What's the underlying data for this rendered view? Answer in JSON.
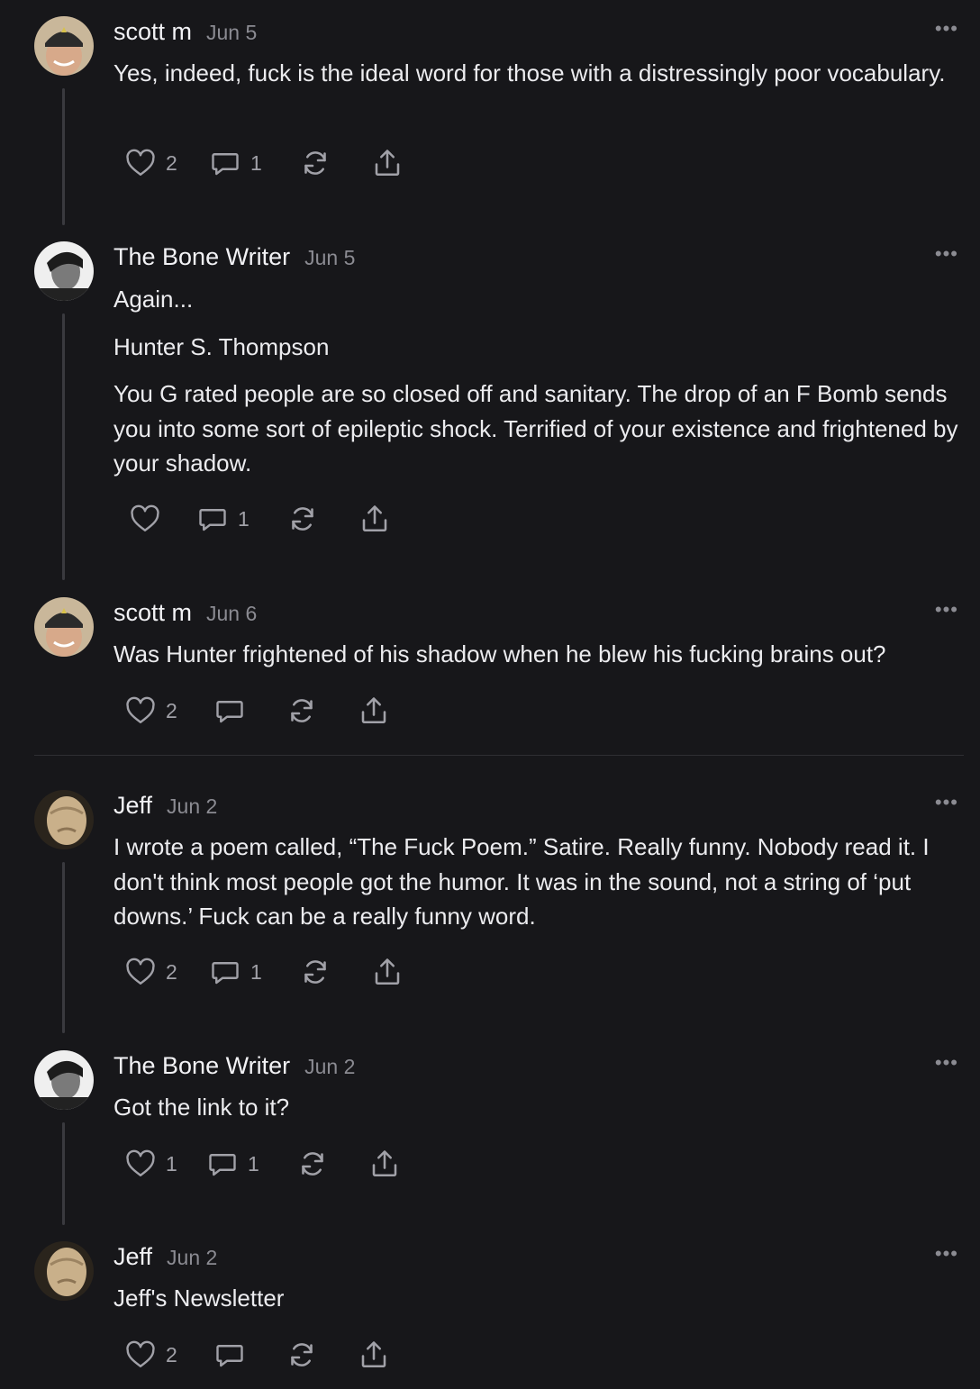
{
  "comments": [
    {
      "author": "scott m",
      "date": "Jun 5",
      "paragraphs": [
        "Yes, indeed, fuck is the ideal word for those with a distressingly poor vocabulary."
      ],
      "likes": "2",
      "replies": "1",
      "more_label": "•••"
    },
    {
      "author": "The Bone Writer",
      "date": "Jun 5",
      "paragraphs": [
        "Again...",
        "Hunter S. Thompson",
        "You G rated people are so closed off and sanitary. The drop of an F Bomb sends you into some sort of epileptic shock. Terrified of your existence and frightened by your shadow."
      ],
      "likes": "",
      "replies": "1",
      "more_label": "•••"
    },
    {
      "author": "scott m",
      "date": "Jun 6",
      "paragraphs": [
        "Was Hunter frightened of his shadow when he blew his fucking brains out?"
      ],
      "likes": "2",
      "replies": "",
      "more_label": "•••"
    },
    {
      "author": "Jeff",
      "date": "Jun 2",
      "paragraphs": [
        "I wrote a poem called, “The Fuck Poem.” Satire. Really funny. Nobody read it. I don't think most people got the humor. It was in the sound, not a string of ‘put downs.’ Fuck can be a really funny word."
      ],
      "likes": "2",
      "replies": "1",
      "more_label": "•••"
    },
    {
      "author": "The Bone Writer",
      "date": "Jun 2",
      "paragraphs": [
        "Got the link to it?"
      ],
      "likes": "1",
      "replies": "1",
      "more_label": "•••"
    },
    {
      "author": "Jeff",
      "date": "Jun 2",
      "paragraphs": [
        "Jeff's Newsletter"
      ],
      "likes": "2",
      "replies": "",
      "more_label": "•••"
    }
  ],
  "icons": {
    "like": "heart-icon",
    "reply": "comment-bubble-icon",
    "restack": "restack-icon",
    "share": "share-icon",
    "more": "more-options-icon"
  },
  "colors": {
    "background": "#17171a",
    "text": "#ececef",
    "muted": "#8b8b92",
    "icon": "#a1a1a8",
    "thread_line": "#3a3a3f"
  }
}
